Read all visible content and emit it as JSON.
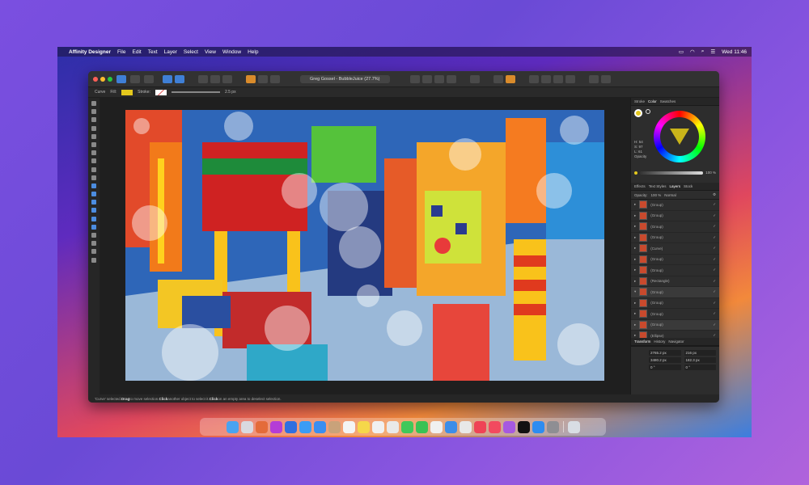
{
  "menubar": {
    "app_name": "Affinity Designer",
    "items": [
      "File",
      "Edit",
      "Text",
      "Layer",
      "Select",
      "View",
      "Window",
      "Help"
    ],
    "clock": "Wed 11:46"
  },
  "window": {
    "document_title": "Greg Gossel - BubbleJuice (27.7%)"
  },
  "context_toolbar": {
    "tool_label": "Curve",
    "fill_label": "Fill:",
    "stroke_label": "Stroke:",
    "stroke_width": "2.5 px"
  },
  "panel": {
    "top_tabs": [
      "Stroke",
      "Color",
      "Swatches"
    ],
    "active_top_tab": "Color",
    "hsl": [
      "H: 54",
      "S: 97",
      "L: 61"
    ],
    "opacity_label": "Opacity",
    "opacity_value": "100 %",
    "layer_tabs": [
      "Effects",
      "Text Styles",
      "Layers",
      "Stock"
    ],
    "layer_opacity_label": "Opacity:",
    "layer_opacity_value": "100 %",
    "blend_mode": "Normal",
    "layers": [
      {
        "name": "(Group)"
      },
      {
        "name": "(Group)"
      },
      {
        "name": "(Group)"
      },
      {
        "name": "(Group)"
      },
      {
        "name": "(Curve)"
      },
      {
        "name": "(Group)"
      },
      {
        "name": "(Group)"
      },
      {
        "name": "(Rectangle)"
      },
      {
        "name": "(Group)"
      },
      {
        "name": "(Group)"
      },
      {
        "name": "(Group)"
      },
      {
        "name": "(Group)"
      },
      {
        "name": "(Ellipse)"
      }
    ],
    "transform_tabs": [
      "Transform",
      "History",
      "Navigator"
    ],
    "transform": {
      "x": "2765.2 px",
      "y": "3480.2 px",
      "w": "216 px",
      "h": "182.3 px",
      "r": "0 °",
      "s": "0 °"
    }
  },
  "status": {
    "text_1": "'Curve' selected. ",
    "drag": "Drag",
    "text_2": " to move selection. ",
    "click1": "Click",
    "text_3": " another object to select it. ",
    "click2": "Click",
    "text_4": " on an empty area to deselect selection."
  },
  "colors": {
    "accent": "#4c8de0",
    "fill": "#e4c81d"
  }
}
